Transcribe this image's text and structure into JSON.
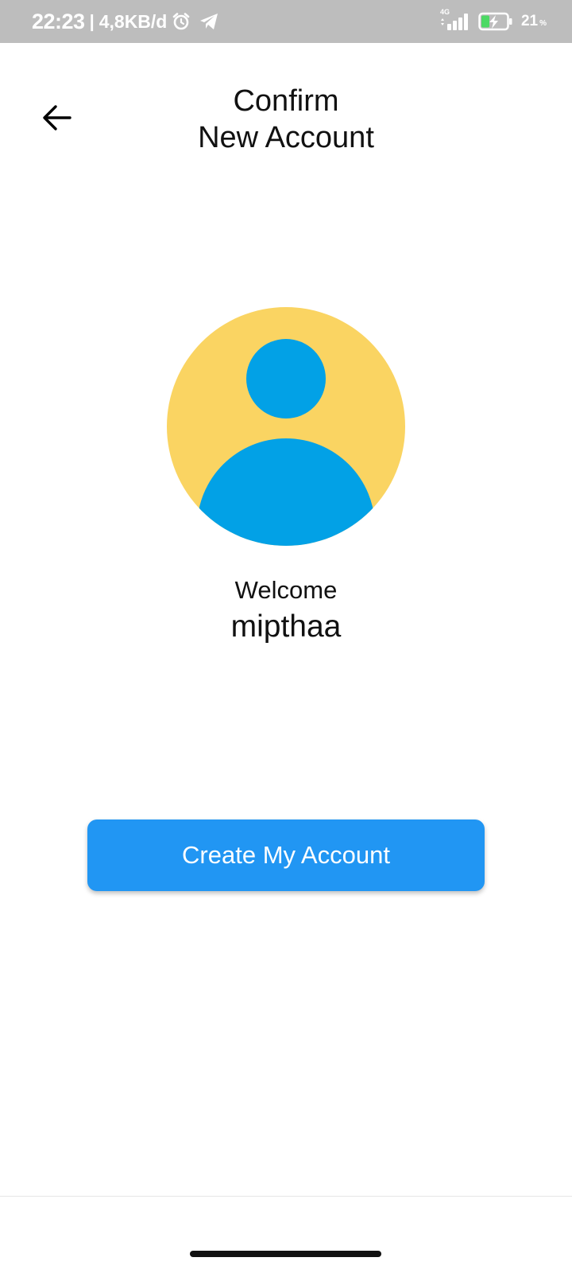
{
  "status_bar": {
    "time": "22:23",
    "separator": "|",
    "network_speed": "4,8KB/d",
    "network_type": "4G",
    "battery_percent": "21",
    "battery_percent_sign": "%",
    "background_color": "#bdbdbd",
    "icons": [
      "alarm-icon",
      "telegram-icon",
      "signal-icon",
      "battery-charging-icon"
    ]
  },
  "header": {
    "back_icon": "arrow-left-icon",
    "title_line1": "Confirm",
    "title_line2": "New Account"
  },
  "avatar": {
    "icon": "default-user-avatar",
    "background_color": "#fad462",
    "figure_color": "#02a1e6"
  },
  "welcome": {
    "label": "Welcome",
    "username": "mipthaa"
  },
  "actions": {
    "create_account_label": "Create My Account",
    "button_color": "#2196f3"
  }
}
